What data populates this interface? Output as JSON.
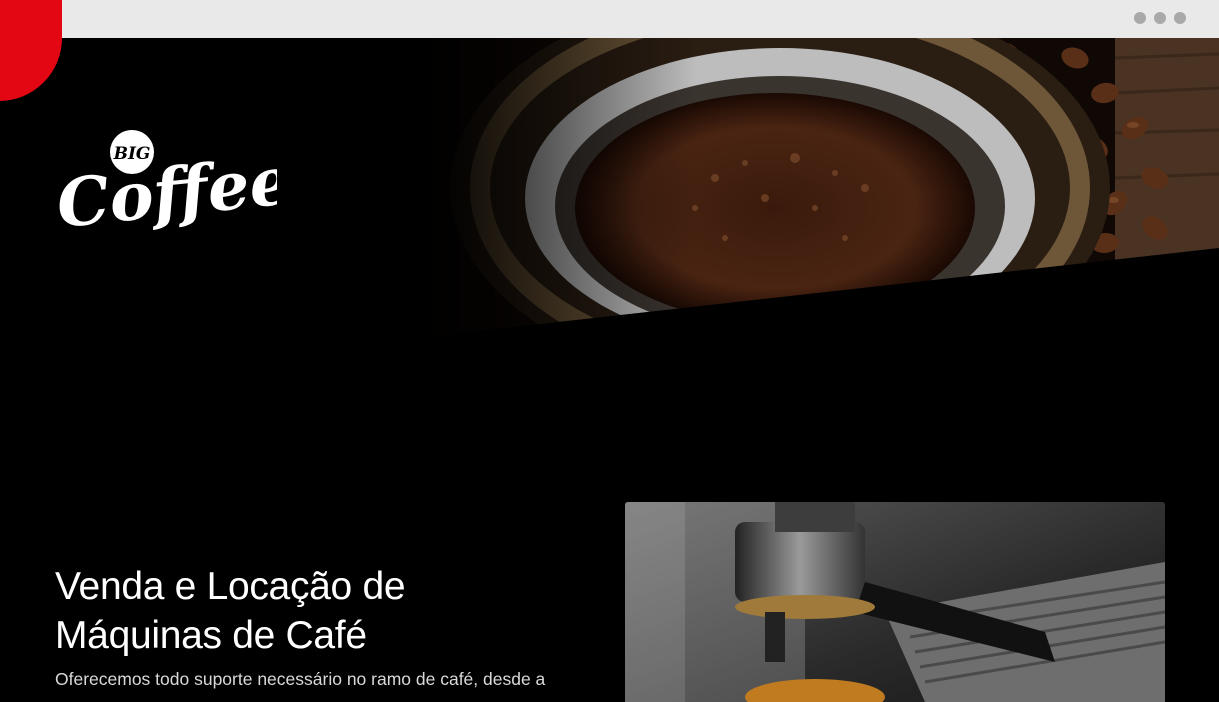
{
  "header": {
    "window_controls": [
      "dot-1",
      "dot-2",
      "dot-3"
    ]
  },
  "menu": {
    "icon": "hamburger-menu-icon",
    "color": "#e30613"
  },
  "brand": {
    "logo_small": "BIG",
    "logo_main": "Coffee"
  },
  "hero": {
    "image": "coffee-cup-and-beans-photo"
  },
  "intro": {
    "title_line1": "Venda e Locação de",
    "title_line2": "Máquinas de Café",
    "lead": "Oferecemos todo suporte necessário no ramo de café, desde a",
    "image": "espresso-machine-photo"
  },
  "colors": {
    "accent": "#e30613",
    "background": "#000000",
    "text": "#ffffff"
  }
}
